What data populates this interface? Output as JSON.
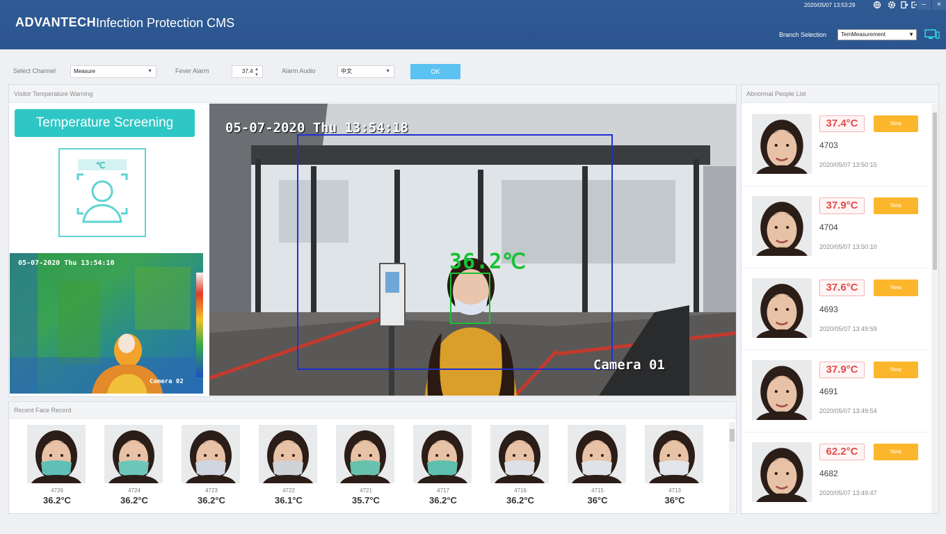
{
  "header": {
    "logo": "ADVANTECH",
    "title": "Infection Protection CMS",
    "datetime": "2020/05/07 13:53:29",
    "branch_label": "Branch Selection",
    "branch_value": "TemMeasurement",
    "icons": [
      "globe-icon",
      "settings-icon",
      "info-icon",
      "logout-icon",
      "minimize-icon",
      "close-icon",
      "monitor-icon"
    ],
    "minimize": "–",
    "close": "×"
  },
  "controls": {
    "channel_label": "Select Channel",
    "channel_value": "Measure",
    "fever_label": "Fever Alarm",
    "fever_value": "37.4",
    "audio_label": "Alarm Audio",
    "audio_value": "中文",
    "ok_label": "OK"
  },
  "warning_panel": {
    "title": "Visitor Temperature Warning",
    "badge": "Temperature Screening",
    "celsius": "℃",
    "thermal_timestamp": "05-07-2020 Thu 13:54:10",
    "thermal_camera": "Camera 02",
    "camera_timestamp": "05-07-2020 Thu 13:54:18",
    "camera_temperature": "36.2℃",
    "camera_name": "Camera 01"
  },
  "recent": {
    "title": "Recent Face Record",
    "items": [
      {
        "id": "4726",
        "temp": "36.2°C",
        "mask": "#5fc0b8"
      },
      {
        "id": "4724",
        "temp": "36.2°C",
        "mask": "#6ec6b9"
      },
      {
        "id": "4723",
        "temp": "36.2°C",
        "mask": "#cfd6e2"
      },
      {
        "id": "4722",
        "temp": "36.1°C",
        "mask": "#cfd3d8"
      },
      {
        "id": "4721",
        "temp": "35.7°C",
        "mask": "#67c1ad"
      },
      {
        "id": "4717",
        "temp": "36.2°C",
        "mask": "#5fbfae"
      },
      {
        "id": "4716",
        "temp": "36.2°C",
        "mask": "#dde1e7"
      },
      {
        "id": "4715",
        "temp": "36°C",
        "mask": "#dfe3e8"
      },
      {
        "id": "4713",
        "temp": "36°C",
        "mask": "#e1e5ea"
      }
    ]
  },
  "abnormal": {
    "title": "Abnormal People List",
    "items": [
      {
        "temp": "37.4°C",
        "badge": "New",
        "id": "4703",
        "time": "2020/05/07 13:50:15"
      },
      {
        "temp": "37.9°C",
        "badge": "New",
        "id": "4704",
        "time": "2020/05/07 13:50:10"
      },
      {
        "temp": "37.6°C",
        "badge": "New",
        "id": "4693",
        "time": "2020/05/07 13:49:59"
      },
      {
        "temp": "37.9°C",
        "badge": "New",
        "id": "4691",
        "time": "2020/05/07 13:49:54"
      },
      {
        "temp": "62.2°C",
        "badge": "New",
        "id": "4682",
        "time": "2020/05/07 13:49:47"
      }
    ]
  }
}
